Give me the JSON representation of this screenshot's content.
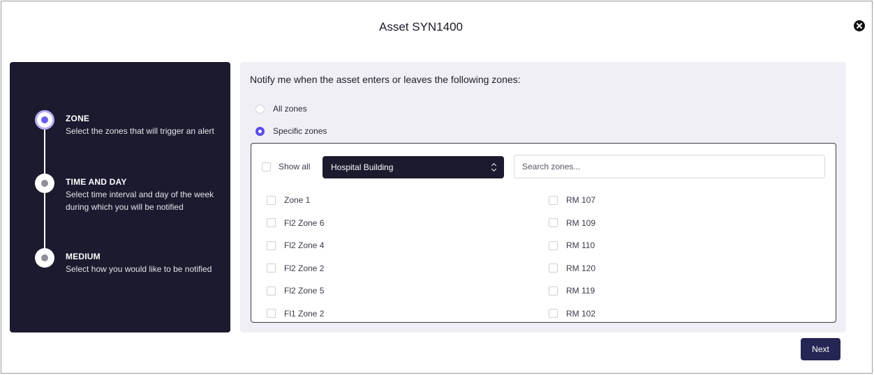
{
  "modal": {
    "title": "Asset SYN1400"
  },
  "steps": [
    {
      "title": "ZONE",
      "description": "Select the zones that will trigger an alert",
      "state": "active"
    },
    {
      "title": "TIME AND DAY",
      "description": "Select time interval and day of the week during which you will be notified",
      "state": "inactive"
    },
    {
      "title": "MEDIUM",
      "description": "Select how you would like to be notified",
      "state": "inactive"
    }
  ],
  "form": {
    "question": "Notify me when the asset enters or leaves the following zones:",
    "options": [
      {
        "label": "All zones",
        "checked": false
      },
      {
        "label": "Specific zones",
        "checked": true
      }
    ],
    "show_all_label": "Show all",
    "building_select": "Hospital Building",
    "search_placeholder": "Search zones...",
    "zones_left": [
      "Zone 1",
      "Fl2 Zone 6",
      "Fl2 Zone 4",
      "Fl2 Zone 2",
      "Fl2 Zone 5",
      "Fl1 Zone 2"
    ],
    "zones_right": [
      "RM 107",
      "RM 109",
      "RM 110",
      "RM 120",
      "RM 119",
      "RM 102"
    ]
  },
  "actions": {
    "next_label": "Next"
  },
  "colors": {
    "panel_dark": "#1b1a2e",
    "accent": "#5a4be6",
    "button": "#252653"
  }
}
